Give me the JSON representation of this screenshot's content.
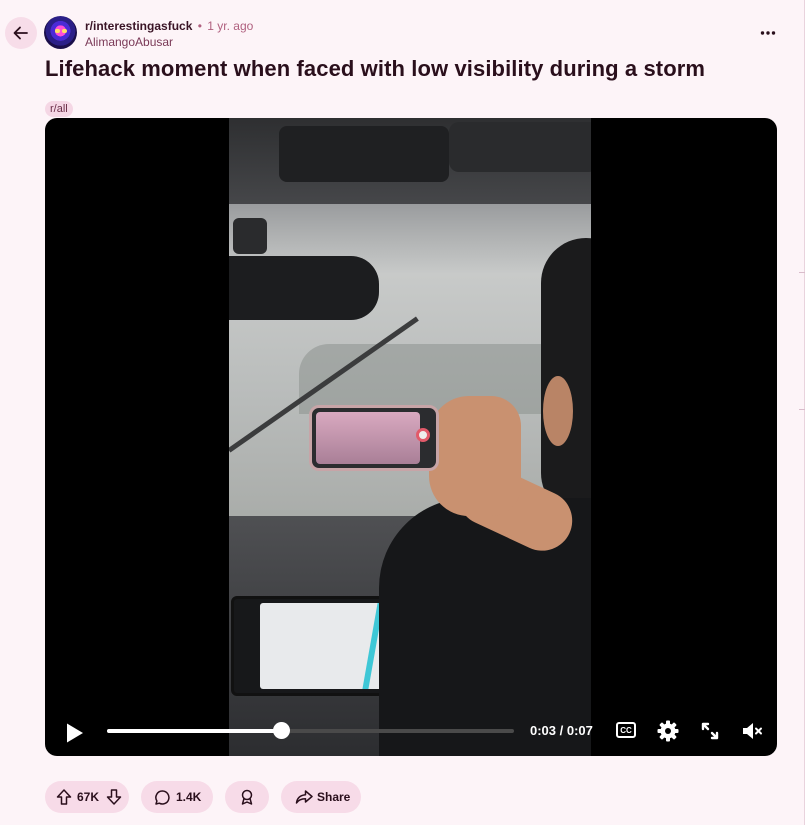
{
  "post": {
    "subreddit": "r/interestingasfuck",
    "separator": "•",
    "age": "1 yr. ago",
    "author": "AlimangoAbusar",
    "title": "Lifehack moment when faced with low visibility during a storm",
    "flair": "r/all"
  },
  "video": {
    "current_time": "0:03",
    "duration": "0:07",
    "time_display": "0:03 / 0:07",
    "progress": 0.4286,
    "cc_label": "CC",
    "muted": true
  },
  "actions": {
    "score": "67K",
    "comments": "1.4K",
    "share_label": "Share"
  },
  "icons": {
    "back": "arrow-left-icon",
    "more": "more-horizontal-icon",
    "play": "play-icon",
    "settings": "gear-icon",
    "fullscreen": "expand-icon",
    "volume": "volume-muted-icon",
    "upvote": "arrow-up-icon",
    "downvote": "arrow-down-icon",
    "comment": "comment-bubble-icon",
    "award": "award-icon",
    "share": "share-arrow-icon"
  },
  "colors": {
    "page_bg": "#fdf4f8",
    "pill_bg": "#f7dbe8",
    "title": "#2a0f1c",
    "meta_accent": "#b0607f",
    "video_bg": "#000000"
  }
}
